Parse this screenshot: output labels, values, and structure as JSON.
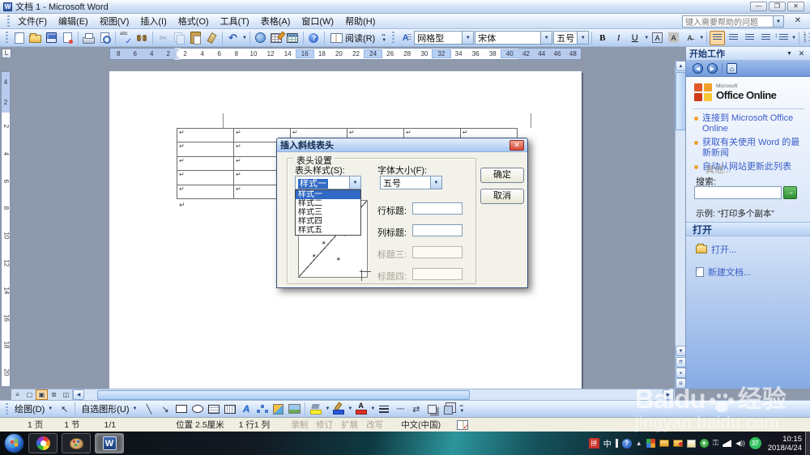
{
  "window": {
    "title": "文档 1 - Microsoft Word"
  },
  "menu": {
    "items": [
      "文件(F)",
      "编辑(E)",
      "视图(V)",
      "插入(I)",
      "格式(O)",
      "工具(T)",
      "表格(A)",
      "窗口(W)",
      "帮助(H)"
    ],
    "help_placeholder": "键入需要帮助的问题"
  },
  "standard_toolbar": {
    "read_label": "阅读(R)"
  },
  "format_toolbar": {
    "style": "网格型",
    "font": "宋体",
    "size": "五号"
  },
  "ruler": {
    "h_left": [
      "8",
      "6",
      "4",
      "2"
    ],
    "h_main": [
      "2",
      "4",
      "6",
      "8",
      "10",
      "12",
      "14",
      "16",
      "18",
      "20",
      "22",
      "24",
      "26",
      "28",
      "30",
      "32",
      "34",
      "36",
      "38",
      "40"
    ],
    "h_right": [
      "42",
      "44",
      "46",
      "48"
    ],
    "h_highlight": [
      "16",
      "24",
      "32",
      "40"
    ],
    "v_top": [
      "4",
      "2"
    ],
    "v_main": [
      "2",
      "4",
      "6",
      "8",
      "10",
      "12",
      "14",
      "16",
      "18",
      "20"
    ]
  },
  "doc": {
    "table_rows": 5,
    "table_cols": 6,
    "cell_mark": "↵"
  },
  "dialog": {
    "title": "插入斜线表头",
    "group": "表头设置",
    "style_label": "表头样式(S):",
    "style_value": "样式一",
    "style_options": [
      "样式一",
      "样式二",
      "样式三",
      "样式四",
      "样式五"
    ],
    "selected_option": 0,
    "size_label": "字体大小(F):",
    "size_value": "五号",
    "rows": [
      {
        "label": "行标题:",
        "value": "",
        "enabled": true
      },
      {
        "label": "列标题:",
        "value": "",
        "enabled": true
      },
      {
        "label": "标题三:",
        "value": "",
        "enabled": false
      },
      {
        "label": "标题四:",
        "value": "",
        "enabled": false
      }
    ],
    "ok": "确定",
    "cancel": "取消"
  },
  "task_pane": {
    "title": "开始工作",
    "brand_small": "Microsoft",
    "brand": "Office Online",
    "links": [
      "连接到 Microsoft Office Online",
      "获取有关使用 Word 的最新新闻",
      "自动从网站更新此列表"
    ],
    "more": "其他...",
    "search_label": "搜索:",
    "example": "示例: “打印多个副本”",
    "open_header": "打开",
    "open_link": "打开...",
    "new_link": "新建文档..."
  },
  "drawing_toolbar": {
    "draw": "绘图(D)",
    "autoshapes": "自选图形(U)"
  },
  "status": {
    "cells": [
      "1 页",
      "1 节",
      "1/1",
      "位置 2.5厘米",
      "1 行",
      "1 列"
    ],
    "modes": [
      "录制",
      "修订",
      "扩展",
      "改写"
    ],
    "lang": "中文(中国)"
  },
  "taskbar": {
    "ime_left": "拼",
    "ime_right": "中",
    "badge": "37",
    "time": "10:15",
    "date": "2018/4/24"
  },
  "watermark": {
    "brand": "Baidu",
    "suffix": "经验",
    "url": "jingyan.baidu.com"
  },
  "colors": {
    "selection_blue": "#316ac5",
    "luna_toolbar": "#c5daf6",
    "active_orange": "#fcd9a4",
    "taskbar_teal": "#2d959c",
    "tray_badge_green": "#18a848"
  }
}
